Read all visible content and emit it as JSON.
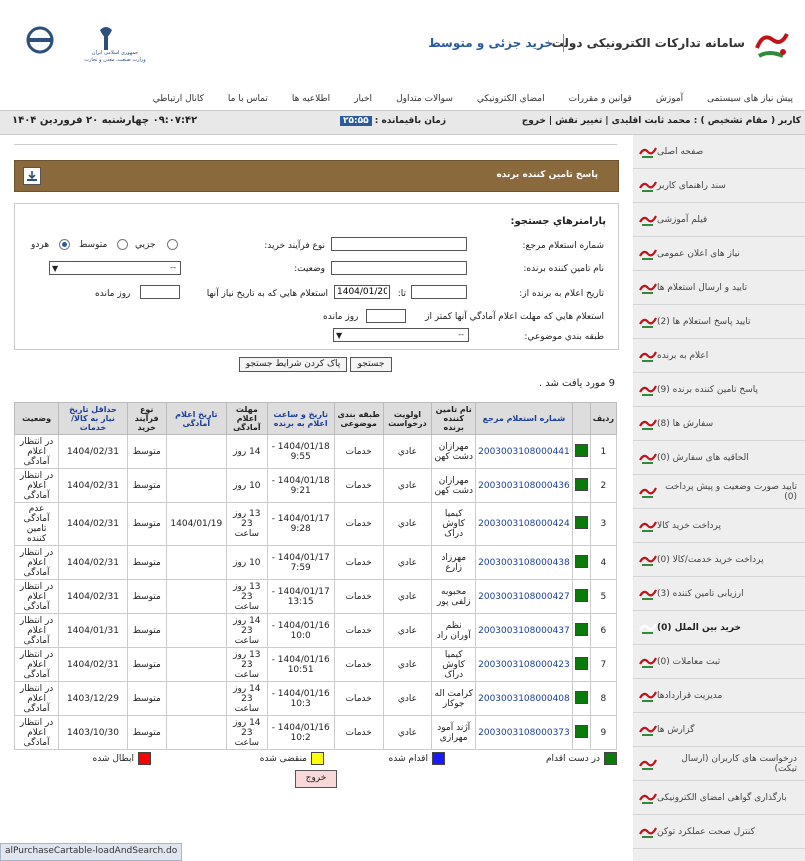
{
  "header": {
    "site_title": "سامانه تدارکات الکترونیکی دولت",
    "site_subtitle": "خرید جزئی و متوسط",
    "emblem_text_1": "جمهوری اسلامی ایران",
    "emblem_text_2": "وزارت صنعت، معدن و تجارت"
  },
  "topnav": [
    "پیش نیاز های سیستمی",
    "آموزش",
    "قوانين و مقررات",
    "امضاي الكترونيكي",
    "سوالات متداول",
    "اخبار",
    "اطلاعیه ها",
    "تماس با ما",
    "كانال ارتباطي"
  ],
  "userbar": {
    "user_label": "کاربر ( مقام تشخیص ) : محمد ثابت اقلیدی",
    "change_role": "تغییر نقش",
    "logout": "خروج",
    "time_label": "زمان باقیمانده :",
    "timer": "۲۵:۵۵",
    "datetime": "۰۹:۰۷:۴۲   چهارشنبه ۲۰ فروردین ۱۴۰۴"
  },
  "sidebar": {
    "items": [
      {
        "label": "صفحه اصلی",
        "active": false
      },
      {
        "label": "سند راهنمای کاربر",
        "active": false
      },
      {
        "label": "فیلم آموزشی",
        "active": false
      },
      {
        "label": "نیاز های اعلان عمومی",
        "active": false
      },
      {
        "label": "تایید و ارسال استعلام ها",
        "active": false
      },
      {
        "label": "تایید پاسخ استعلام ها (2)",
        "active": false
      },
      {
        "label": "اعلام به برنده",
        "active": false
      },
      {
        "label": "پاسخ تامین کننده برنده (9)",
        "active": false
      },
      {
        "label": "سفارش ها (8)",
        "active": false
      },
      {
        "label": "الحاقیه های سفارش (0)",
        "active": false
      },
      {
        "label": "تایید صورت وضعیت و پیش پرداخت (0)",
        "active": false
      },
      {
        "label": "پرداخت خرید کالا",
        "active": false
      },
      {
        "label": "پرداخت خرید خدمت/کالا (0)",
        "active": false
      },
      {
        "label": "ارزیابی تامین کننده (3)",
        "active": false
      },
      {
        "label": "خرید بین الملل (0)",
        "active": true
      },
      {
        "label": "ثبت معاملات  (0)",
        "active": false
      },
      {
        "label": "مدیریت قراردادها",
        "active": false
      },
      {
        "label": "گزارش ها",
        "active": false
      },
      {
        "label": "درخواست های کاربران (ارسال تیکت)",
        "active": false
      },
      {
        "label": "بارگذاری گواهی امضای الکترونیکی",
        "active": false
      },
      {
        "label": "کنترل صحت عملکرد توکن",
        "active": false
      }
    ]
  },
  "page": {
    "title": "پاسخ تامين كننده برنده"
  },
  "search": {
    "heading": "پارامترهاي جستجو:",
    "ref_number_label": "شماره استعلام مرجع:",
    "process_type_label": "نوع فرآيند خريد:",
    "radio_small": "جزيي",
    "radio_medium": "متوسط",
    "radio_both": "هردو",
    "supplier_label": "نام تامين كننده برنده:",
    "status_label": "وضعيت:",
    "status_value": "--",
    "date_from_label": "تاريخ اعلام به برنده از:",
    "date_to_label": "تا:",
    "date_to_value": "1404/01/20",
    "need_date_label": "استعلام هايي كه به تاريخ نياز آنها",
    "days_left_label": "روز مانده",
    "deadline_label": "استعلام هايي كه مهلت اعلام آمادگي آنها كمتر از",
    "days_left_label_2": "روز مانده",
    "category_label": "طبقه بندي موضوعي:",
    "category_value": "--",
    "search_button": "جستجو",
    "clear_button": "پاک کردن شرايط جستجو"
  },
  "result_count": "9 مورد يافت شد .",
  "table": {
    "headers": [
      {
        "label": "رديف",
        "link": false
      },
      {
        "label": "",
        "link": false
      },
      {
        "label": "شماره استعلام مرجع",
        "link": true
      },
      {
        "label": "نام تامين كننده برنده",
        "link": false
      },
      {
        "label": "اولويت درخواست",
        "link": false
      },
      {
        "label": "طبقه بندی موضوعی",
        "link": false
      },
      {
        "label": "تاريخ و ساعت اعلام به برنده",
        "link": true
      },
      {
        "label": "مهلت اعلام آمادگی",
        "link": false
      },
      {
        "label": "تاریخ اعلام آمادگی",
        "link": true
      },
      {
        "label": "نوع فرآيند خريد",
        "link": false
      },
      {
        "label": "حداقل تاريخ نياز به كالا/خدمات",
        "link": true
      },
      {
        "label": "وضعيت",
        "link": false
      }
    ],
    "rows": [
      {
        "n": "1",
        "ref": "2003003108000441",
        "supplier": "مهرازان دشت کهن",
        "priority": "عادي",
        "category": "خدمات",
        "announce": "1404/01/18 - 9:55",
        "deadline": "14 روز",
        "ready_date": "",
        "type": "متوسط",
        "need_date": "1404/02/31",
        "status": "در انتظار اعلام آمادگی"
      },
      {
        "n": "2",
        "ref": "2003003108000436",
        "supplier": "مهرازان دشت کهن",
        "priority": "عادي",
        "category": "خدمات",
        "announce": "1404/01/18 - 9:21",
        "deadline": "10 روز",
        "ready_date": "",
        "type": "متوسط",
        "need_date": "1404/02/31",
        "status": "در انتظار اعلام آمادگی"
      },
      {
        "n": "3",
        "ref": "2003003108000424",
        "supplier": "کیمیا کاوش دراک",
        "priority": "عادي",
        "category": "خدمات",
        "announce": "1404/01/17 - 9:28",
        "deadline": "13 روز 23 ساعت",
        "ready_date": "1404/01/19",
        "type": "متوسط",
        "need_date": "1404/02/31",
        "status": "عدم آمادگی تامین کننده"
      },
      {
        "n": "4",
        "ref": "2003003108000438",
        "supplier": "مهرزاد زارع",
        "priority": "عادي",
        "category": "خدمات",
        "announce": "1404/01/17 - 7:59",
        "deadline": "10 روز",
        "ready_date": "",
        "type": "متوسط",
        "need_date": "1404/02/31",
        "status": "در انتظار اعلام آمادگی"
      },
      {
        "n": "5",
        "ref": "2003003108000427",
        "supplier": "محبوبه زلفی پور",
        "priority": "عادي",
        "category": "خدمات",
        "announce": "1404/01/17 - 13:15",
        "deadline": "13 روز 23 ساعت",
        "ready_date": "",
        "type": "متوسط",
        "need_date": "1404/02/31",
        "status": "در انتظار اعلام آمادگی"
      },
      {
        "n": "6",
        "ref": "2003003108000437",
        "supplier": "نظم آوران راد",
        "priority": "عادي",
        "category": "خدمات",
        "announce": "1404/01/16 - 10:0",
        "deadline": "14 روز 23 ساعت",
        "ready_date": "",
        "type": "متوسط",
        "need_date": "1404/01/31",
        "status": "در انتظار اعلام آمادگی"
      },
      {
        "n": "7",
        "ref": "2003003108000423",
        "supplier": "کیمیا کاوش دراک",
        "priority": "عادي",
        "category": "خدمات",
        "announce": "1404/01/16 - 10:51",
        "deadline": "13 روز 23 ساعت",
        "ready_date": "",
        "type": "متوسط",
        "need_date": "1404/02/31",
        "status": "در انتظار اعلام آمادگی"
      },
      {
        "n": "8",
        "ref": "2003003108000408",
        "supplier": "کرامت اله جوکار",
        "priority": "عادي",
        "category": "خدمات",
        "announce": "1404/01/16 - 10:3",
        "deadline": "14 روز 23 ساعت",
        "ready_date": "",
        "type": "متوسط",
        "need_date": "1403/12/29",
        "status": "در انتظار اعلام آمادگی"
      },
      {
        "n": "9",
        "ref": "2003003108000373",
        "supplier": "آژند آمود مهرازی",
        "priority": "عادي",
        "category": "خدمات",
        "announce": "1404/01/16 - 10:2",
        "deadline": "14 روز 23 ساعت",
        "ready_date": "",
        "type": "متوسط",
        "need_date": "1403/10/30",
        "status": "در انتظار اعلام آمادگی"
      }
    ]
  },
  "legend": {
    "in_progress": "در دست اقدام",
    "done": "اقدام شده",
    "expired": "منقضی شده",
    "cancelled": "ابطال شده",
    "colors": {
      "in_progress": "#0a7a0a",
      "done": "#1a1aff",
      "expired": "#ffff00",
      "cancelled": "#ff0000"
    }
  },
  "exit_button": "خروج",
  "statusbar_url": "alPurchaseCartable-loadAndSearch.do"
}
